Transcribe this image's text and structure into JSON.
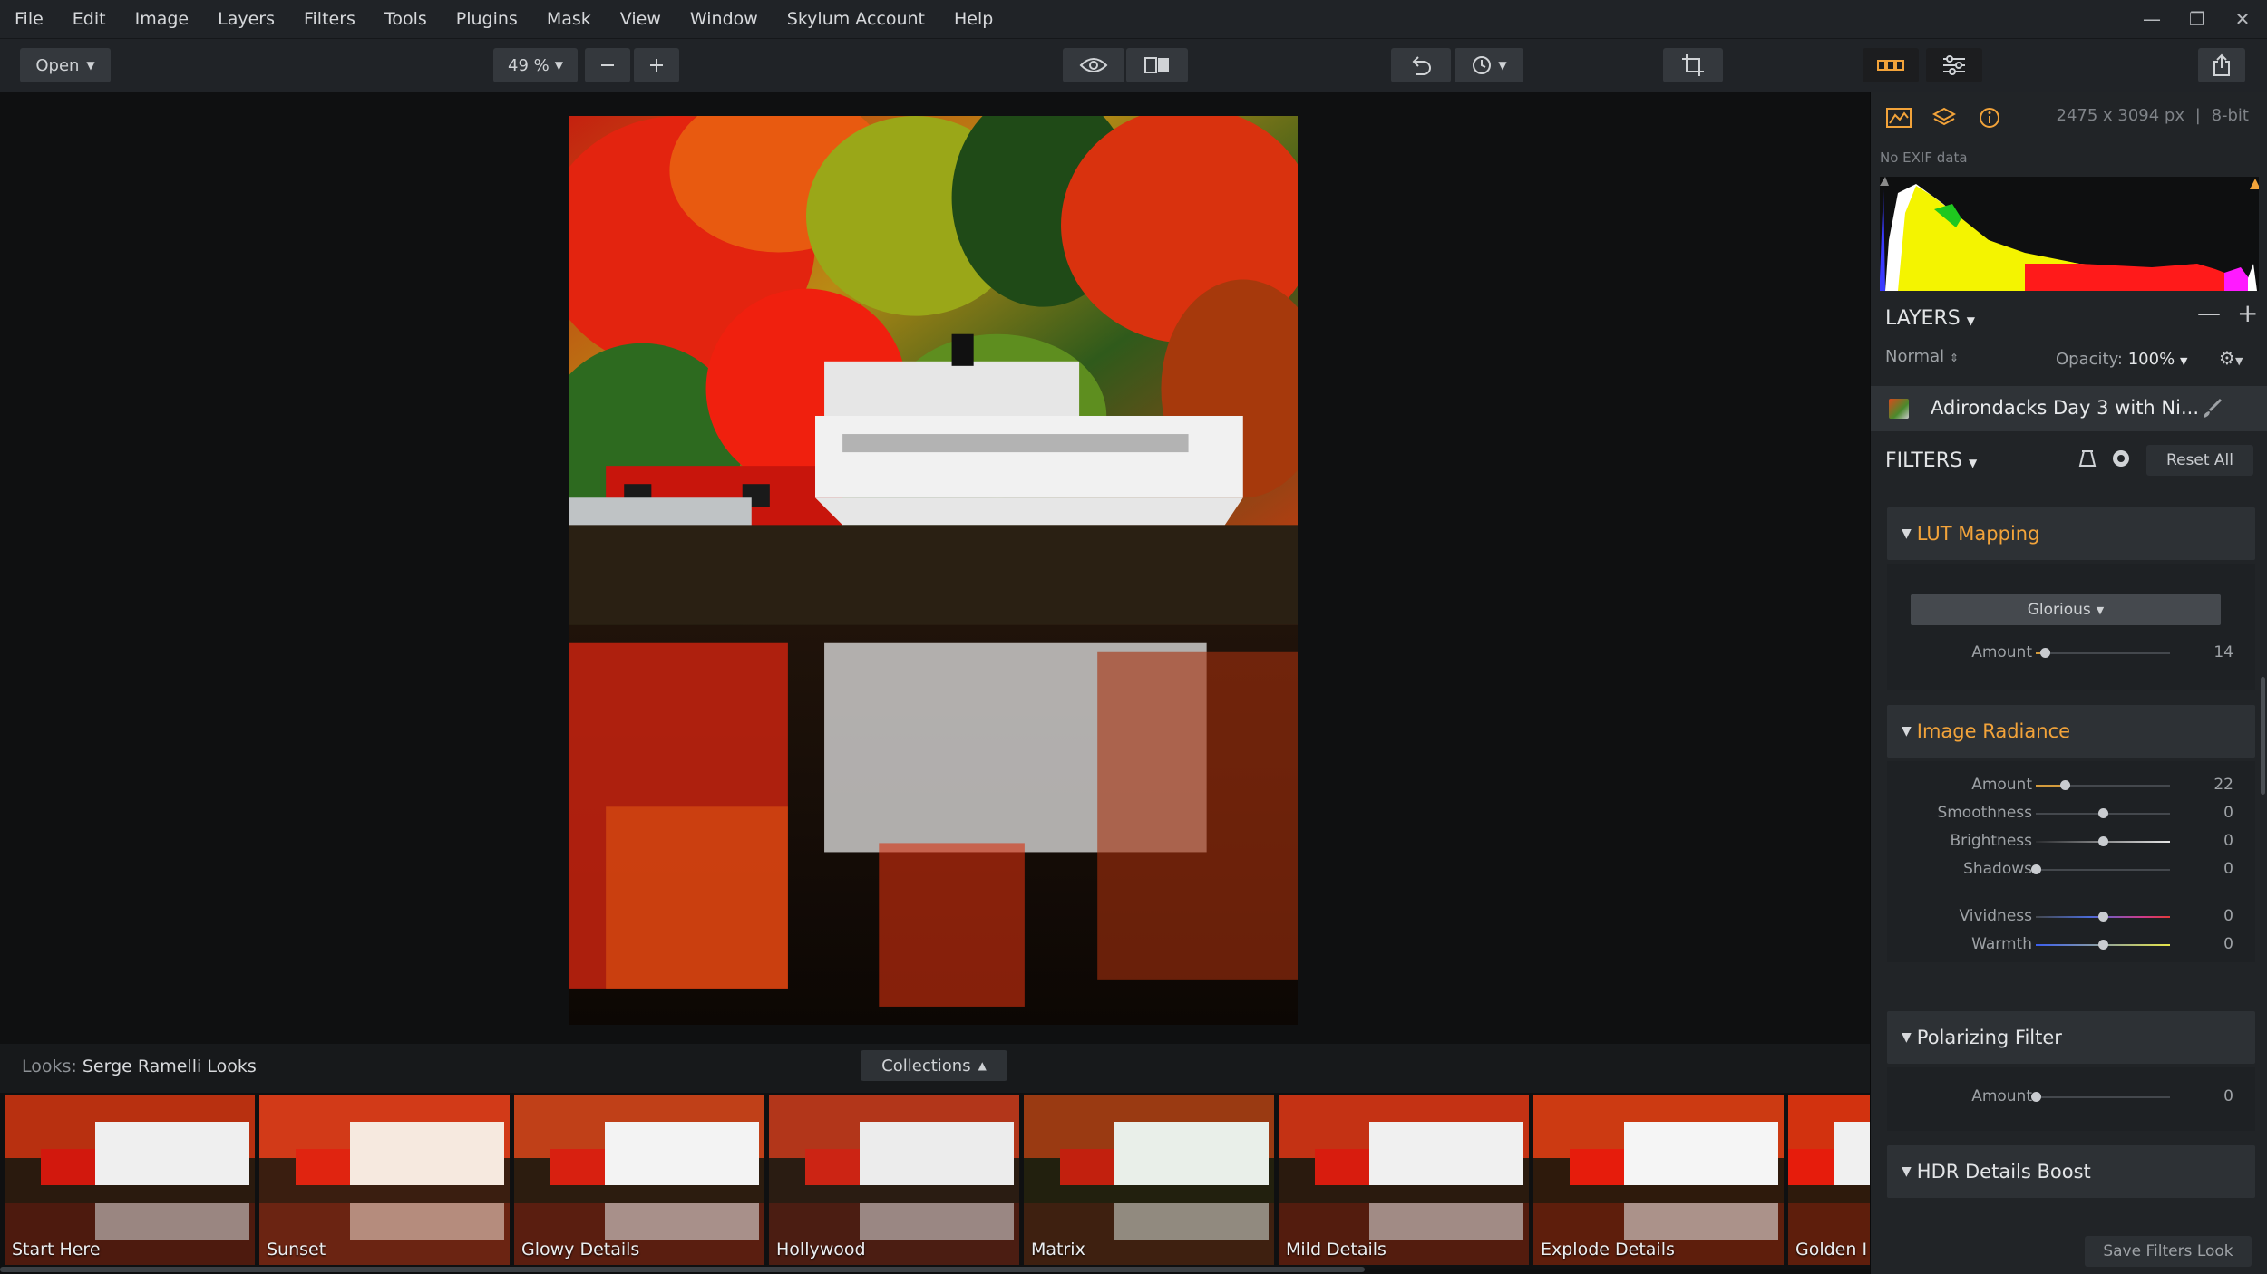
{
  "menu": {
    "items": [
      "File",
      "Edit",
      "Image",
      "Layers",
      "Filters",
      "Tools",
      "Plugins",
      "Mask",
      "View",
      "Window",
      "Skylum Account",
      "Help"
    ]
  },
  "window_controls": {
    "minimize": "—",
    "restore": "❐",
    "close": "✕"
  },
  "toolbar": {
    "open_label": "Open",
    "zoom_label": "49 %",
    "icons": [
      "zoom-out-icon",
      "zoom-in-icon",
      "preview-eye-icon",
      "compare-icon",
      "undo-icon",
      "history-icon",
      "crop-icon",
      "looks-panel-icon",
      "filters-panel-icon",
      "export-icon"
    ]
  },
  "looks": {
    "label": "Looks:",
    "collection_name": "Serge Ramelli Looks",
    "collections_button": "Collections",
    "thumbnails": [
      "Start Here",
      "Sunset",
      "Glowy Details",
      "Hollywood",
      "Matrix",
      "Mild Details",
      "Explode Details",
      "Golden I"
    ]
  },
  "info_panel": {
    "image_size": "2475 x 3094 px",
    "bit_depth": "8-bit",
    "size_separator": "|",
    "exif": "No EXIF data"
  },
  "layers": {
    "title": "LAYERS",
    "blend_mode": "Normal",
    "opacity_label": "Opacity:",
    "opacity_value": "100%",
    "layer_name": "Adirondacks Day 3 with Ni..."
  },
  "filters": {
    "title": "FILTERS",
    "reset_label": "Reset All",
    "save_look_label": "Save Filters Look",
    "lut_mapping": {
      "title": "LUT Mapping",
      "lut_value": "Glorious",
      "amount_label": "Amount",
      "amount_value": "14",
      "amount_fraction": 0.07
    },
    "image_radiance": {
      "title": "Image Radiance",
      "sliders": [
        {
          "label": "Amount",
          "value": "22",
          "fraction": 0.22
        },
        {
          "label": "Smoothness",
          "value": "0",
          "fraction": 0.5
        },
        {
          "label": "Brightness",
          "value": "0",
          "fraction": 0.5
        },
        {
          "label": "Shadows",
          "value": "0",
          "fraction": 0.0
        },
        {
          "label": "Vividness",
          "value": "0",
          "fraction": 0.5
        },
        {
          "label": "Warmth",
          "value": "0",
          "fraction": 0.5
        }
      ]
    },
    "polarizing_filter": {
      "title": "Polarizing Filter",
      "amount_label": "Amount",
      "amount_value": "0",
      "amount_fraction": 0.0
    },
    "hdr_details_boost": {
      "title": "HDR Details Boost"
    }
  },
  "colors": {
    "accent": "#f2a33a",
    "panel_bg": "#212427",
    "toolbar_bg": "#202327",
    "canvas_bg": "#0f1011"
  }
}
